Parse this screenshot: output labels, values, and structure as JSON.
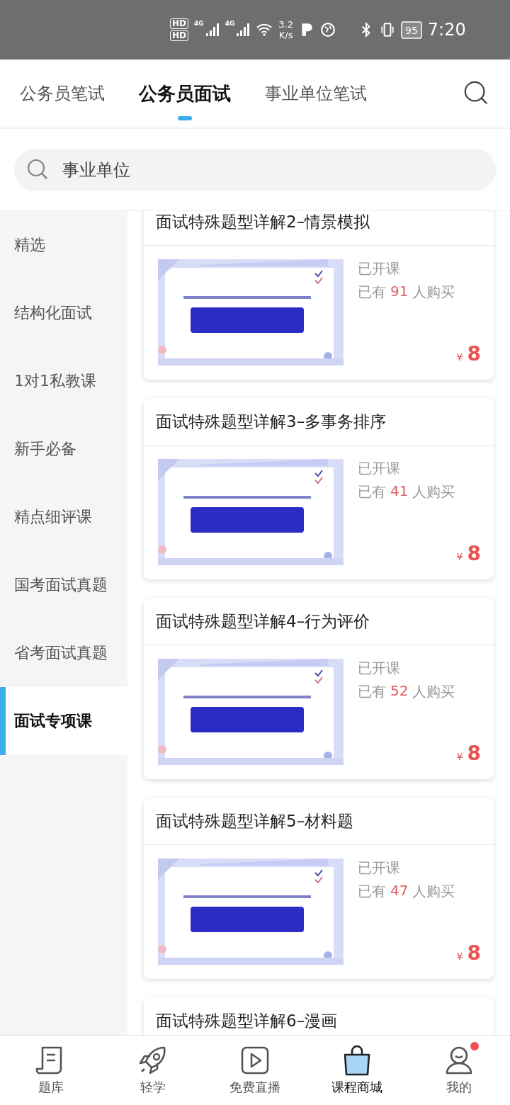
{
  "status_bar": {
    "hd": [
      "HD",
      "HD"
    ],
    "network": [
      "4G",
      "4G"
    ],
    "speed": "3.2",
    "speed_unit": "K/s",
    "battery": "95",
    "time": "7:20"
  },
  "tabs": [
    {
      "label": "公务员笔试",
      "selected": false
    },
    {
      "label": "公务员面试",
      "selected": true
    },
    {
      "label": "事业单位笔试",
      "selected": false
    }
  ],
  "search": {
    "value": "事业单位"
  },
  "sidebar": {
    "items": [
      {
        "label": "精选",
        "selected": false
      },
      {
        "label": "结构化面试",
        "selected": false
      },
      {
        "label": "1对1私教课",
        "selected": false
      },
      {
        "label": "新手必备",
        "selected": false
      },
      {
        "label": "精点细评课",
        "selected": false
      },
      {
        "label": "国考面试真题",
        "selected": false
      },
      {
        "label": "省考面试真题",
        "selected": false
      },
      {
        "label": "面试专项课",
        "selected": true
      }
    ]
  },
  "courses": [
    {
      "title": "面试特殊题型详解2–情景模拟",
      "status": "已开课",
      "buyers_prefix": "已有",
      "buyers": "91",
      "buyers_suffix": "人购买",
      "currency": "¥",
      "price": "8"
    },
    {
      "title": "面试特殊题型详解3–多事务排序",
      "status": "已开课",
      "buyers_prefix": "已有",
      "buyers": "41",
      "buyers_suffix": "人购买",
      "currency": "¥",
      "price": "8"
    },
    {
      "title": "面试特殊题型详解4–行为评价",
      "status": "已开课",
      "buyers_prefix": "已有",
      "buyers": "52",
      "buyers_suffix": "人购买",
      "currency": "¥",
      "price": "8"
    },
    {
      "title": "面试特殊题型详解5–材料题",
      "status": "已开课",
      "buyers_prefix": "已有",
      "buyers": "47",
      "buyers_suffix": "人购买",
      "currency": "¥",
      "price": "8"
    },
    {
      "title": "面试特殊题型详解6–漫画"
    }
  ],
  "bottom_nav": [
    {
      "label": "题库",
      "kind": "bank",
      "selected": false,
      "badge": false
    },
    {
      "label": "轻学",
      "kind": "rocket",
      "selected": false,
      "badge": false
    },
    {
      "label": "免费直播",
      "kind": "play",
      "selected": false,
      "badge": false
    },
    {
      "label": "课程商城",
      "kind": "bag",
      "selected": true,
      "badge": false
    },
    {
      "label": "我的",
      "kind": "person",
      "selected": false,
      "badge": true
    }
  ]
}
